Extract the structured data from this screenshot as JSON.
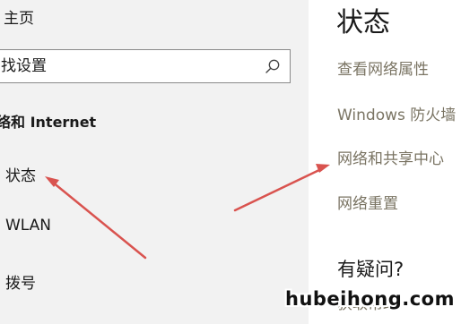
{
  "sidebar": {
    "home_label": "主页",
    "search": {
      "value": "",
      "placeholder": "找设置"
    },
    "section_heading": "络和 Internet",
    "items": [
      {
        "label": "状态"
      },
      {
        "label": "WLAN"
      },
      {
        "label": "拨号"
      }
    ]
  },
  "main": {
    "title": "状态",
    "links": [
      {
        "label": "查看网络属性"
      },
      {
        "label": "Windows 防火墙"
      },
      {
        "label": "网络和共享中心"
      },
      {
        "label": "网络重置"
      }
    ],
    "help_heading": "有疑问?",
    "help_link_partial": "获取帮助"
  },
  "annotations": {
    "arrow_color": "#d9534f"
  },
  "watermark": "hubeihong.com"
}
